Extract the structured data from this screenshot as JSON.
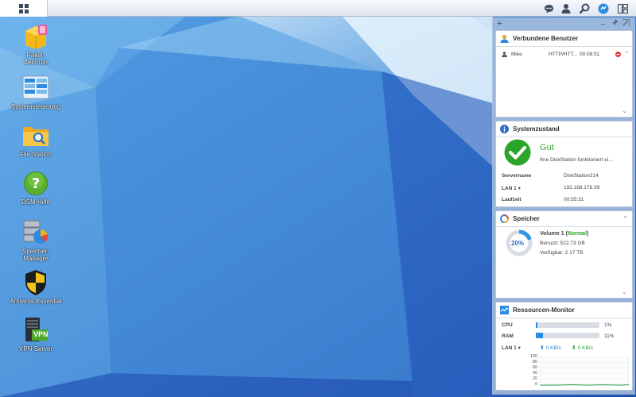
{
  "desktop": {
    "icons": [
      {
        "label": "Paket-\nZentrum",
        "icon": "package-center-icon"
      },
      {
        "label": "Systemsteuerung",
        "icon": "control-panel-icon"
      },
      {
        "label": "File Station",
        "icon": "file-station-icon"
      },
      {
        "label": "DSM Hilfe",
        "icon": "help-icon"
      },
      {
        "label": "Speicher-\nManager",
        "icon": "storage-manager-icon"
      },
      {
        "label": "Antivirus Essential",
        "icon": "antivirus-icon"
      },
      {
        "label": "VPN Server",
        "icon": "vpn-server-icon"
      }
    ],
    "vpn_badge": "VPN"
  },
  "taskbar": {
    "tray_icons": [
      "chat-icon",
      "user-icon",
      "search-icon",
      "notification-icon",
      "widgets-icon"
    ]
  },
  "panel": {
    "add_label": "+",
    "minimize_label": "–",
    "pin_label": "⊣"
  },
  "widgets": {
    "users": {
      "title": "Verbundene Benutzer",
      "rows": [
        {
          "user": "Mike",
          "protocol": "HTTP/HTT...",
          "time": "00:08:51"
        }
      ]
    },
    "health": {
      "title": "Systemzustand",
      "status": "Gut",
      "message": "Ihre DiskStation funktioniert ei...",
      "servername_label": "Servername",
      "servername_value": "DiskStation214",
      "lan_label": "LAN 1",
      "lan_value": "192.168.178.39",
      "uptime_label": "Laufzeit",
      "uptime_value": "00:55:31"
    },
    "storage": {
      "title": "Speicher",
      "percent_label": "20%",
      "percent_value": 20,
      "volume_name": "Volume 1 (",
      "volume_status": "Normal",
      "volume_close": ")",
      "used": "Benutzt: 522.73 GB",
      "free": "Verfügbar: 2.17 TB"
    },
    "resources": {
      "title": "Ressourcen-Monitor",
      "cpu_label": "CPU",
      "cpu_value": 1,
      "cpu_text": "1%",
      "ram_label": "RAM",
      "ram_value": 11,
      "ram_text": "11%",
      "lan_label": "LAN 1",
      "upload": "0 KB/s",
      "download": "0 KB/s",
      "y_ticks": [
        "100",
        "80",
        "60",
        "40",
        "20",
        "0"
      ]
    }
  },
  "colors": {
    "accent": "#2a8be0",
    "good": "#2aa52a",
    "storage_ring": "#2e96e6"
  }
}
